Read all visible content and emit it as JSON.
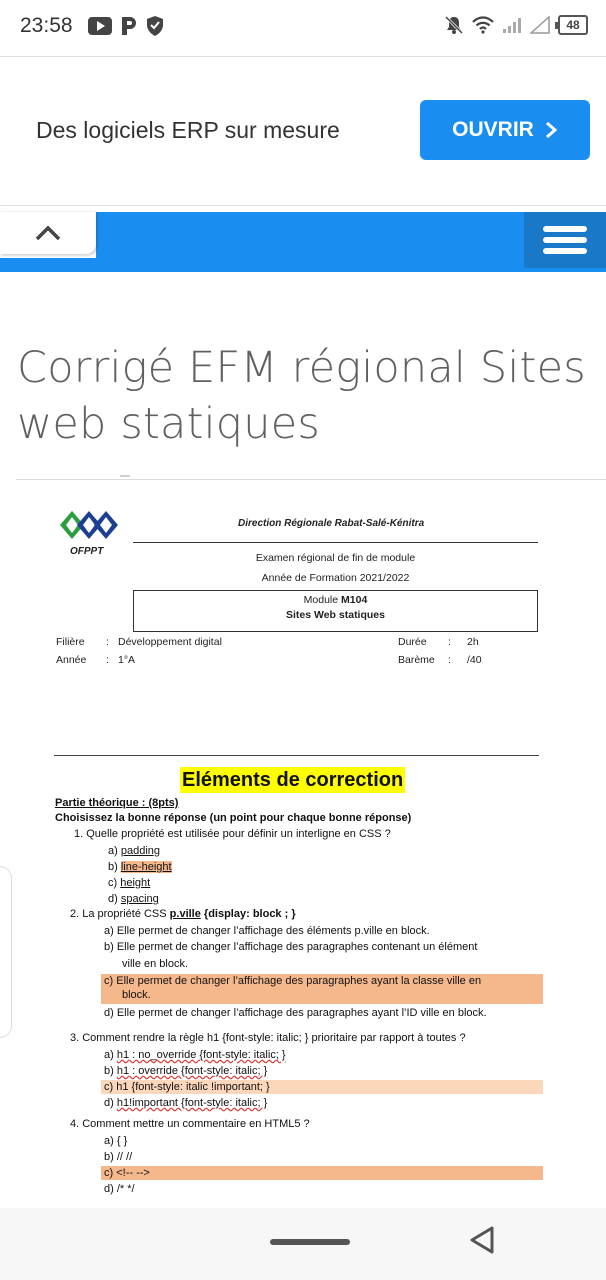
{
  "status_bar": {
    "time": "23:58",
    "battery": "48",
    "left_icons": [
      "youtube-icon",
      "p-icon",
      "shield-icon"
    ],
    "right_icons": [
      "mute-icon",
      "wifi-icon",
      "signal-icon",
      "signal-empty-icon",
      "battery-icon"
    ]
  },
  "ad": {
    "text": "Des logiciels ERP sur mesure",
    "button_label": "OUVRIR",
    "button_color": "#1a8ef0"
  },
  "toolbar": {
    "accent": "#1a8ef0",
    "menu_color": "#1a78c8"
  },
  "article": {
    "title": "Corrigé EFM régional Sites web statiques"
  },
  "doc": {
    "logo_label": "OFPPT",
    "direction": "Direction Régionale Rabat-Salé-Kénitra",
    "exam": "Examen régional de fin de module",
    "annee_formation": "Année de Formation 2021/2022",
    "module_prefix": "Module",
    "module_code": "M104",
    "module_name": "Sites Web statiques",
    "filiere_label": "Filière",
    "filiere_value": "Développement digital",
    "annee_label": "Année",
    "annee_value": "1°A",
    "duree_label": "Durée",
    "duree_value": "2h",
    "bareme_label": "Barème",
    "bareme_value": "/40",
    "colon": ":",
    "heading": "Eléments de correction",
    "part": "Partie théorique : (8pts)",
    "instruction": "Choisissez la bonne réponse (un point pour chaque bonne réponse)",
    "q1": {
      "text": "1.  Quelle propriété est utilisée pour définir un interligne en CSS ?",
      "a": "padding",
      "b": "line-height",
      "c": "height",
      "d": "spacing"
    },
    "q2": {
      "prefix": "2.  La propriété CSS ",
      "code": "p.ville",
      "suffix": " {display: block ; }",
      "a": "Elle  permet de changer l’affichage des éléments p.ville en block.",
      "b1": "Elle  permet de changer l’affichage des paragraphes contenant un élément",
      "b2": "ville en block.",
      "c1": "Elle  permet de changer l’affichage des paragraphes ayant la classe ville en",
      "c2": "block.",
      "d": "Elle  permet de changer l’affichage des paragraphes ayant l’ID ville en block."
    },
    "q3": {
      "text": "3.  Comment rendre la règle h1 {font-style: italic; } prioritaire par rapport à toutes ?",
      "a": "h1 : no_override {font-style: italic; }",
      "b": "h1 : override {font-style: italic; }",
      "c": "h1 {font-style: italic !important; }",
      "d": "h1!important {font-style: italic; }"
    },
    "q4": {
      "text": "4.  Comment mettre un commentaire en HTML5 ?",
      "a": "{ }",
      "b": "// //",
      "c": "<!-- -->",
      "d": "/* */"
    },
    "letters": [
      "a)",
      "b)",
      "c)",
      "d)"
    ],
    "highlight_dark": "#f5b88c",
    "highlight_light": "#fcd7bb",
    "heading_bg": "#ffff00"
  }
}
